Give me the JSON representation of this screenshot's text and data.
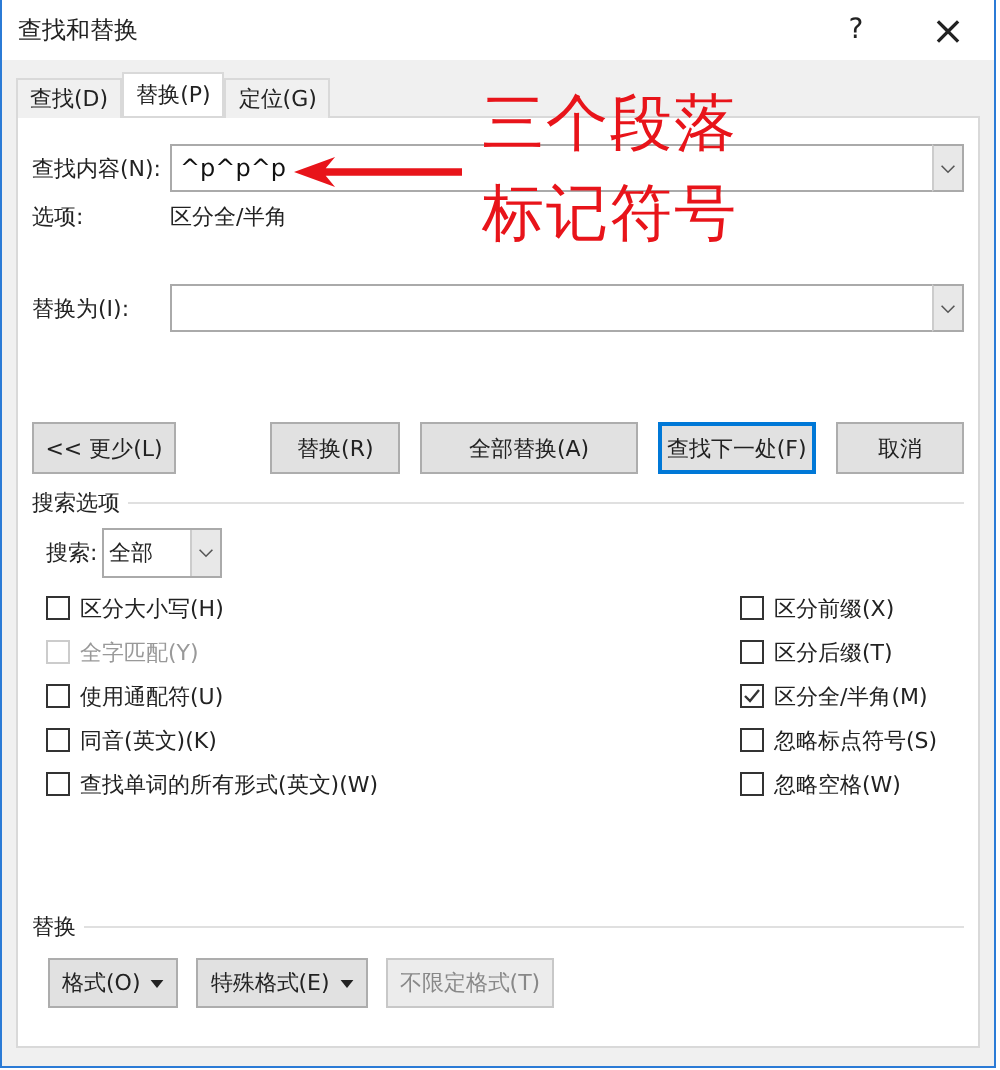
{
  "window": {
    "title": "查找和替换",
    "help": "?",
    "close": "×"
  },
  "tabs": [
    {
      "label": "查找(D)",
      "selected": false
    },
    {
      "label": "替换(P)",
      "selected": true
    },
    {
      "label": "定位(G)",
      "selected": false
    }
  ],
  "find": {
    "label": "查找内容(N):",
    "value": "^p^p^p",
    "options_label": "选项:",
    "options_value": "区分全/半角"
  },
  "replace": {
    "label": "替换为(I):"
  },
  "buttons": [
    {
      "label": "<< 更少(L)",
      "focused": false
    },
    {
      "label": "替换(R)",
      "focused": false
    },
    {
      "label": "全部替换(A)",
      "focused": false
    },
    {
      "label": "查找下一处(F)",
      "focused": true
    },
    {
      "label": "取消",
      "focused": false
    }
  ],
  "search_options": {
    "title": "搜索选项",
    "search_label": "搜索:",
    "search_value": "全部",
    "left": [
      {
        "label": "区分大小写(H)",
        "checked": false,
        "disabled": false
      },
      {
        "label": "全字匹配(Y)",
        "checked": false,
        "disabled": true
      },
      {
        "label": "使用通配符(U)",
        "checked": false,
        "disabled": false
      },
      {
        "label": "同音(英文)(K)",
        "checked": false,
        "disabled": false
      },
      {
        "label": "查找单词的所有形式(英文)(W)",
        "checked": false,
        "disabled": false
      }
    ],
    "right": [
      {
        "label": "区分前缀(X)",
        "checked": false,
        "disabled": false
      },
      {
        "label": "区分后缀(T)",
        "checked": false,
        "disabled": false
      },
      {
        "label": "区分全/半角(M)",
        "checked": true,
        "disabled": false
      },
      {
        "label": "忽略标点符号(S)",
        "checked": false,
        "disabled": false
      },
      {
        "label": "忽略空格(W)",
        "checked": false,
        "disabled": false
      }
    ]
  },
  "replace_section": {
    "title": "替换",
    "buttons": [
      {
        "label": "格式(O)",
        "dropdown": true,
        "disabled": false
      },
      {
        "label": "特殊格式(E)",
        "dropdown": true,
        "disabled": false
      },
      {
        "label": "不限定格式(T)",
        "dropdown": false,
        "disabled": true
      }
    ]
  },
  "annotation": {
    "lines": [
      "三个段落",
      "标记符号"
    ]
  }
}
